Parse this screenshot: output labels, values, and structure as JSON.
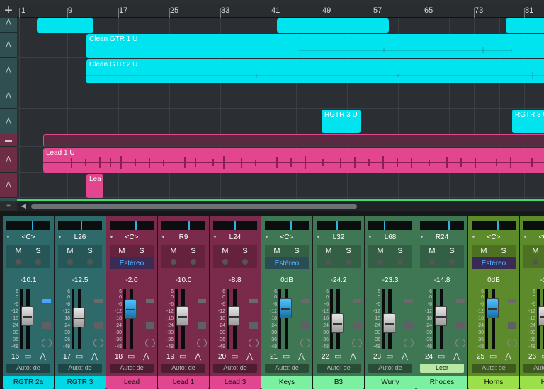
{
  "toolbar": {
    "add_icon": "plus-icon"
  },
  "ruler": {
    "bars": [
      "1",
      "9",
      "17",
      "25",
      "33",
      "41",
      "49",
      "57",
      "65",
      "73",
      "81"
    ]
  },
  "clips": {
    "clean1": "Clean GTR 1 U",
    "clean2": "Clean GTR 2 U",
    "rgtr3a": "RGTR 3 U",
    "rgtr3b": "RGTR 3 U",
    "lead1": "Lead 1 U",
    "lea": "Lea"
  },
  "mixer": {
    "strips": [
      {
        "num": "16",
        "pan": "<C>",
        "volume": "-10.1",
        "automation": "Auto: de",
        "name": "RGTR 2a"
      },
      {
        "num": "17",
        "pan": "L26",
        "volume": "-12.5",
        "automation": "Auto: de",
        "name": "RGTR 3"
      },
      {
        "num": "18",
        "pan": "<C>",
        "volume": "-2.0",
        "automation": "Auto: de",
        "name": "Lead",
        "stereo": "Estéreo"
      },
      {
        "num": "19",
        "pan": "R9",
        "volume": "-10.0",
        "automation": "Auto: de",
        "name": "Lead 1"
      },
      {
        "num": "20",
        "pan": "L24",
        "volume": "-8.8",
        "automation": "Auto: de",
        "name": "Lead 3"
      },
      {
        "num": "21",
        "pan": "<C>",
        "volume": "0dB",
        "automation": "Auto: de",
        "name": "Keys",
        "stereo": "Estéreo"
      },
      {
        "num": "22",
        "pan": "L32",
        "volume": "-24.2",
        "automation": "Auto: de",
        "name": "B3"
      },
      {
        "num": "23",
        "pan": "L68",
        "volume": "-23.3",
        "automation": "Auto: de",
        "name": "Wurly"
      },
      {
        "num": "24",
        "pan": "R24",
        "volume": "-14.8",
        "automation": "Leer",
        "name": "Rhodes"
      },
      {
        "num": "25",
        "pan": "<C>",
        "volume": "0dB",
        "automation": "Auto: de",
        "name": "Horns",
        "stereo": "Estéreo"
      },
      {
        "num": "26",
        "pan": "<C>",
        "volume": "-13",
        "automation": "Auto: de",
        "name": "Ho"
      }
    ],
    "scale": [
      "6",
      "0",
      "-6",
      "-12",
      "-18",
      "-24",
      "-30",
      "-36",
      "-48"
    ],
    "mute_label": "M",
    "solo_label": "S"
  },
  "colors": {
    "teal": "#2f6a6b",
    "pink": "#7a2a4b",
    "green": "#3f7654",
    "lime": "#5d8a2a",
    "cyan": "#00e4f0",
    "magenta": "#e2468f"
  }
}
